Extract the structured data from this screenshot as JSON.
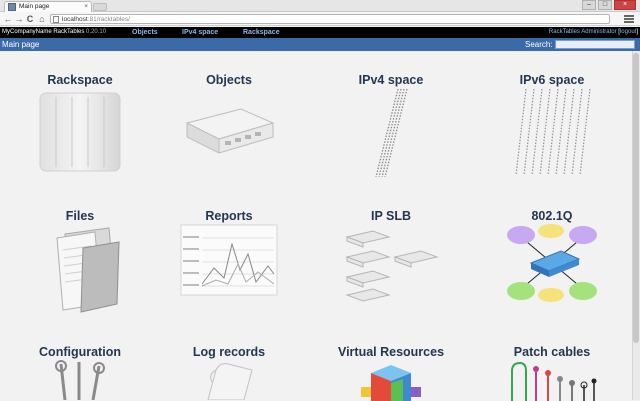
{
  "browser": {
    "tab_title": "Main page",
    "tab_close": "×",
    "url_host": "localhost",
    "url_rest": ":81/racktables/",
    "win_min": "–",
    "win_max": "□",
    "win_close": "×",
    "back": "←",
    "forward": "→",
    "reload": "C",
    "home": "⌂"
  },
  "header": {
    "company": "MyCompanyName RackTables",
    "version": "0.20.10",
    "nav": [
      "Objects",
      "IPv4 space",
      "Rackspace"
    ],
    "user": "RackTables Administrator",
    "logout": "logout",
    "bracket_open": "[",
    "bracket_close": "]"
  },
  "mainbar": {
    "breadcrumb": "Main page",
    "search_label": "Search:",
    "search_value": ""
  },
  "tiles": [
    {
      "label": "Rackspace",
      "icon": "rackspace-icon"
    },
    {
      "label": "Objects",
      "icon": "server-icon"
    },
    {
      "label": "IPv4 space",
      "icon": "ipv4-icon"
    },
    {
      "label": "IPv6 space",
      "icon": "ipv6-icon"
    },
    {
      "label": "Files",
      "icon": "files-icon"
    },
    {
      "label": "Reports",
      "icon": "reports-icon"
    },
    {
      "label": "IP SLB",
      "icon": "ipslb-icon"
    },
    {
      "label": "802.1Q",
      "icon": "vlan-icon"
    },
    {
      "label": "Configuration",
      "icon": "tools-icon"
    },
    {
      "label": "Log records",
      "icon": "log-icon"
    },
    {
      "label": "Virtual Resources",
      "icon": "cubes-icon"
    },
    {
      "label": "Patch cables",
      "icon": "cables-icon"
    }
  ],
  "colors": {
    "header_bg": "#000000",
    "mainbar_bg": "#3b6aa8",
    "tile_text": "#243650",
    "link": "#8fb6e0"
  }
}
